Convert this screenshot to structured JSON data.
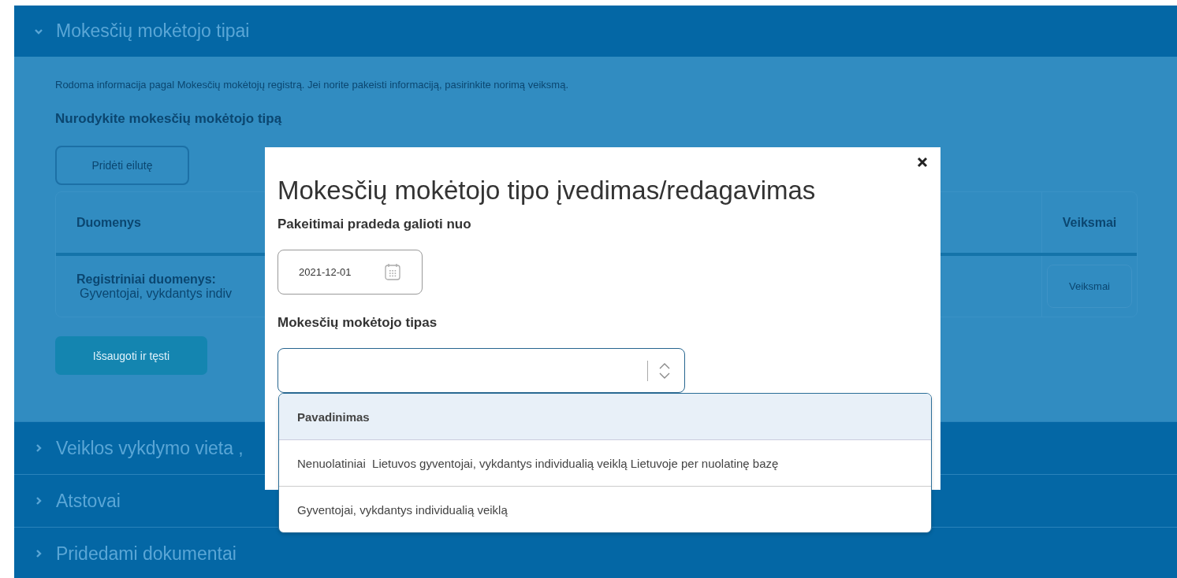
{
  "sections": [
    {
      "title": "Mokesčių mokėtojo tipai",
      "expanded": true
    },
    {
      "title": "Veiklos vykdymo vieta ,",
      "expanded": false
    },
    {
      "title": "Atstovai",
      "expanded": false
    },
    {
      "title": "Pridedami dokumentai",
      "expanded": false
    }
  ],
  "panel": {
    "info": "Rodoma informacija pagal Mokesčių mokėtojų registrą. Jei norite pakeisti informaciją, pasirinkite norimą veiksmą.",
    "heading": "Nurodykite mokesčių mokėtojo tipą",
    "add_button": "Pridėti eilutę",
    "table": {
      "columns": [
        "Duomenys",
        "Veiksmai"
      ],
      "rows": [
        {
          "label": "Registriniai duomenys:",
          "value": "Gyventojai, vykdantys indiv",
          "action": "Veiksmai"
        }
      ]
    },
    "save_button": "Išsaugoti ir tęsti"
  },
  "modal": {
    "title": "Mokesčių mokėtojo tipo įvedimas/redagavimas",
    "date_label": "Pakeitimai pradeda galioti nuo",
    "date_value": "2021-12-01",
    "type_label": "Mokesčių mokėtojo tipas",
    "dropdown": {
      "open": true,
      "header": "Pavadinimas",
      "options": [
        "Nenuolatiniai  Lietuvos gyventojai, vykdantys individualią veiklą Lietuvoje per nuolatinę bazę",
        "Gyventojai, vykdantys individualią veiklą"
      ]
    }
  }
}
